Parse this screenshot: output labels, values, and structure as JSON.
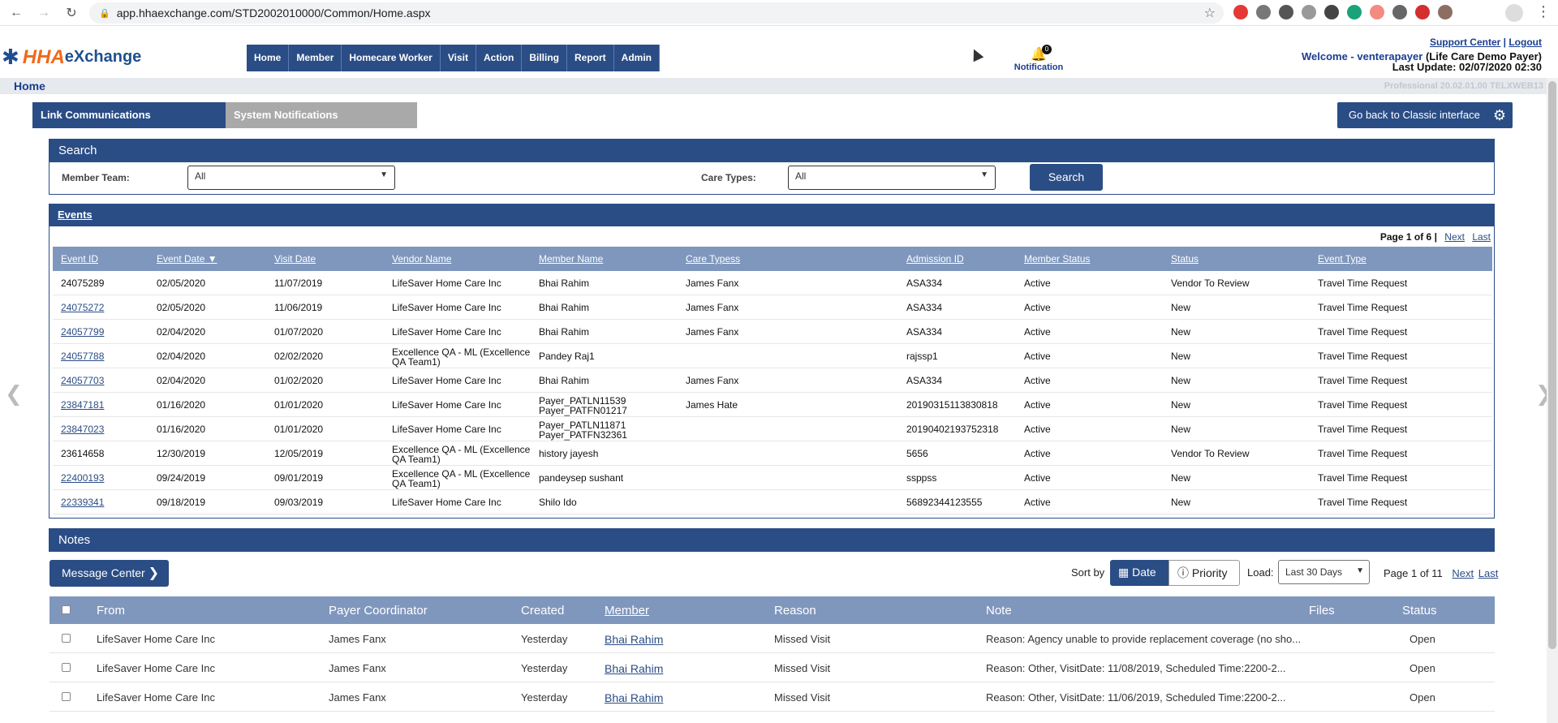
{
  "browser": {
    "url": "app.hhaexchange.com/STD2002010000/Common/Home.aspx"
  },
  "header": {
    "logo_hha": "HHA",
    "logo_ex": "eXchange",
    "nav": [
      "Home",
      "Member",
      "Homecare Worker",
      "Visit",
      "Action",
      "Billing",
      "Report",
      "Admin"
    ],
    "notification_count": "0",
    "notification_label": "Notification",
    "support_link": "Support Center",
    "sep": "|",
    "logout_link": "Logout",
    "welcome": "Welcome - venterapayer",
    "welcome_org": "(Life Care Demo Payer)",
    "last_update": "Last Update: 02/07/2020 02:30"
  },
  "breadcrumb": {
    "home": "Home",
    "version": "Professional 20.02.01.00 TELXWEB13"
  },
  "tabs": {
    "link": "Link Communications",
    "system": "System Notifications",
    "classic": "Go back to Classic interface"
  },
  "search": {
    "title": "Search",
    "member_team_label": "Member Team:",
    "member_team_value": "All",
    "care_types_label": "Care Types:",
    "care_types_value": "All",
    "button": "Search"
  },
  "events": {
    "title": "Events",
    "page_info": "Page 1 of 6 |",
    "next": "Next",
    "last": "Last",
    "columns": [
      "Event ID",
      "Event Date ▼",
      "Visit Date",
      "Vendor Name",
      "Member Name",
      "Care Typess",
      "Admission ID",
      "Member Status",
      "Status",
      "Event Type"
    ],
    "rows": [
      {
        "id": "24075289",
        "date": "02/05/2020",
        "visit": "11/07/2019",
        "vendor": "LifeSaver Home Care Inc",
        "vendor2": "",
        "member": "Bhai Rahim",
        "member2": "",
        "care": "James Fanx",
        "adm": "ASA334",
        "mstatus": "Active",
        "status": "Vendor To Review",
        "type": "Travel Time Request",
        "link": false
      },
      {
        "id": "24075272",
        "date": "02/05/2020",
        "visit": "11/06/2019",
        "vendor": "LifeSaver Home Care Inc",
        "vendor2": "",
        "member": "Bhai Rahim",
        "member2": "",
        "care": "James Fanx",
        "adm": "ASA334",
        "mstatus": "Active",
        "status": "New",
        "type": "Travel Time Request",
        "link": true
      },
      {
        "id": "24057799",
        "date": "02/04/2020",
        "visit": "01/07/2020",
        "vendor": "LifeSaver Home Care Inc",
        "vendor2": "",
        "member": "Bhai Rahim",
        "member2": "",
        "care": "James Fanx",
        "adm": "ASA334",
        "mstatus": "Active",
        "status": "New",
        "type": "Travel Time Request",
        "link": true
      },
      {
        "id": "24057788",
        "date": "02/04/2020",
        "visit": "02/02/2020",
        "vendor": "Excellence QA - ML (Excellence",
        "vendor2": "QA Team1)",
        "member": "Pandey Raj1",
        "member2": "",
        "care": "",
        "adm": "rajssp1",
        "mstatus": "Active",
        "status": "New",
        "type": "Travel Time Request",
        "link": true
      },
      {
        "id": "24057703",
        "date": "02/04/2020",
        "visit": "01/02/2020",
        "vendor": "LifeSaver Home Care Inc",
        "vendor2": "",
        "member": "Bhai Rahim",
        "member2": "",
        "care": "James Fanx",
        "adm": "ASA334",
        "mstatus": "Active",
        "status": "New",
        "type": "Travel Time Request",
        "link": true
      },
      {
        "id": "23847181",
        "date": "01/16/2020",
        "visit": "01/01/2020",
        "vendor": "LifeSaver Home Care Inc",
        "vendor2": "",
        "member": "Payer_PATLN11539",
        "member2": "Payer_PATFN01217",
        "care": "James Hate",
        "adm": "20190315113830818",
        "mstatus": "Active",
        "status": "New",
        "type": "Travel Time Request",
        "link": true
      },
      {
        "id": "23847023",
        "date": "01/16/2020",
        "visit": "01/01/2020",
        "vendor": "LifeSaver Home Care Inc",
        "vendor2": "",
        "member": "Payer_PATLN11871",
        "member2": "Payer_PATFN32361",
        "care": "",
        "adm": "20190402193752318",
        "mstatus": "Active",
        "status": "New",
        "type": "Travel Time Request",
        "link": true
      },
      {
        "id": "23614658",
        "date": "12/30/2019",
        "visit": "12/05/2019",
        "vendor": "Excellence QA - ML (Excellence",
        "vendor2": "QA Team1)",
        "member": "history jayesh",
        "member2": "",
        "care": "",
        "adm": "5656",
        "mstatus": "Active",
        "status": "Vendor To Review",
        "type": "Travel Time Request",
        "link": false
      },
      {
        "id": "22400193",
        "date": "09/24/2019",
        "visit": "09/01/2019",
        "vendor": "Excellence QA - ML (Excellence",
        "vendor2": "QA Team1)",
        "member": "pandeysep sushant",
        "member2": "",
        "care": "",
        "adm": "ssppss",
        "mstatus": "Active",
        "status": "New",
        "type": "Travel Time Request",
        "link": true
      },
      {
        "id": "22339341",
        "date": "09/18/2019",
        "visit": "09/03/2019",
        "vendor": "LifeSaver Home Care Inc",
        "vendor2": "",
        "member": "Shilo Ido",
        "member2": "",
        "care": "",
        "adm": "56892344123555",
        "mstatus": "Active",
        "status": "New",
        "type": "Travel Time Request",
        "link": true
      }
    ]
  },
  "notes": {
    "title": "Notes",
    "message_center": "Message Center",
    "sort_by": "Sort by",
    "sort_date": "Date",
    "sort_priority": "Priority",
    "load_label": "Load:",
    "load_value": "Last 30 Days",
    "page_info": "Page 1 of 11",
    "next": "Next",
    "last": "Last",
    "columns": [
      "From",
      "Payer Coordinator",
      "Created",
      "Member",
      "Reason",
      "Note",
      "Files",
      "Status"
    ],
    "rows": [
      {
        "from": "LifeSaver Home Care Inc",
        "coord": "James Fanx",
        "created": "Yesterday",
        "member": "Bhai Rahim",
        "reason": "Missed Visit",
        "note": "Reason: Agency unable to provide replacement coverage (no sho...",
        "files": "",
        "status": "Open"
      },
      {
        "from": "LifeSaver Home Care Inc",
        "coord": "James Fanx",
        "created": "Yesterday",
        "member": "Bhai Rahim",
        "reason": "Missed Visit",
        "note": "Reason: Other, VisitDate: 11/08/2019, Scheduled Time:2200-2...",
        "files": "",
        "status": "Open"
      },
      {
        "from": "LifeSaver Home Care Inc",
        "coord": "James Fanx",
        "created": "Yesterday",
        "member": "Bhai Rahim",
        "reason": "Missed Visit",
        "note": "Reason: Other, VisitDate: 11/06/2019, Scheduled Time:2200-2...",
        "files": "",
        "status": "Open"
      }
    ]
  }
}
